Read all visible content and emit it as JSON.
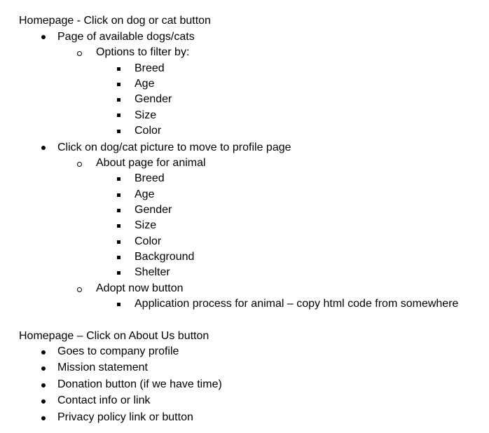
{
  "section1": {
    "heading": "Homepage - Click on dog or cat button",
    "items": [
      {
        "text": "Page of available dogs/cats",
        "sub": [
          {
            "text": "Options to filter by:",
            "sub": [
              "Breed",
              "Age",
              "Gender",
              "Size",
              "Color"
            ]
          }
        ]
      },
      {
        "text": "Click on dog/cat picture to move to profile page",
        "sub": [
          {
            "text": "About page for animal",
            "sub": [
              "Breed",
              "Age",
              "Gender",
              "Size",
              "Color",
              "Background",
              "Shelter"
            ]
          },
          {
            "text": "Adopt now button",
            "sub": [
              "Application process for animal – copy html code from somewhere"
            ]
          }
        ]
      }
    ]
  },
  "section2": {
    "heading": "Homepage – Click on About Us button",
    "items": [
      "Goes to company profile",
      "Mission statement",
      "Donation button (if we have time)",
      "Contact info or link",
      "Privacy policy link or button"
    ]
  }
}
